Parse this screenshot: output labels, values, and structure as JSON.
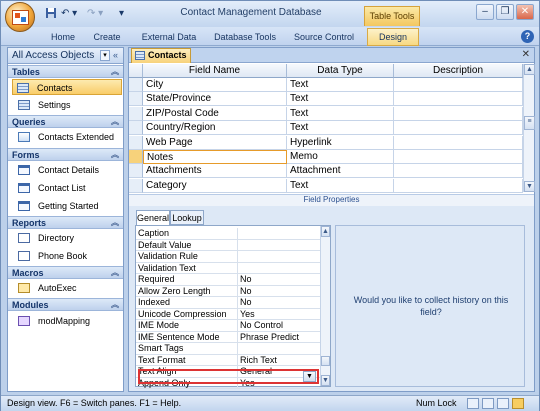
{
  "app": {
    "title": "Contact Management Database",
    "contextual_group": "Table Tools"
  },
  "qat": {
    "undo": "↶ ▾",
    "redo": "↷ ▾",
    "customize": "▾"
  },
  "window_controls": {
    "minimize": "–",
    "restore": "❐",
    "close": "✕"
  },
  "ribbon": {
    "tabs": [
      "Home",
      "Create",
      "External Data",
      "Database Tools",
      "Source Control",
      "Design"
    ],
    "active": "Design"
  },
  "help": "?",
  "nav": {
    "title": "All Access Objects",
    "groups": [
      {
        "label": "Tables",
        "items": [
          "Contacts",
          "Settings"
        ]
      },
      {
        "label": "Queries",
        "items": [
          "Contacts Extended"
        ]
      },
      {
        "label": "Forms",
        "items": [
          "Contact Details",
          "Contact List",
          "Getting Started"
        ]
      },
      {
        "label": "Reports",
        "items": [
          "Directory",
          "Phone Book"
        ]
      },
      {
        "label": "Macros",
        "items": [
          "AutoExec"
        ]
      },
      {
        "label": "Modules",
        "items": [
          "modMapping"
        ]
      }
    ],
    "selected": "Contacts"
  },
  "document": {
    "tab": "Contacts",
    "close": "✕"
  },
  "grid": {
    "columns": [
      "Field Name",
      "Data Type",
      "Description"
    ],
    "rows": [
      {
        "field": "City",
        "type": "Text",
        "desc": ""
      },
      {
        "field": "State/Province",
        "type": "Text",
        "desc": ""
      },
      {
        "field": "ZIP/Postal Code",
        "type": "Text",
        "desc": ""
      },
      {
        "field": "Country/Region",
        "type": "Text",
        "desc": ""
      },
      {
        "field": "Web Page",
        "type": "Hyperlink",
        "desc": ""
      },
      {
        "field": "Notes",
        "type": "Memo",
        "desc": ""
      },
      {
        "field": "Attachments",
        "type": "Attachment",
        "desc": ""
      },
      {
        "field": "Category",
        "type": "Text",
        "desc": ""
      }
    ],
    "current_row": "Notes"
  },
  "field_properties": {
    "label": "Field Properties",
    "tabs": [
      "General",
      "Lookup"
    ],
    "active_tab": "General",
    "rows": [
      {
        "name": "Caption",
        "value": ""
      },
      {
        "name": "Default Value",
        "value": ""
      },
      {
        "name": "Validation Rule",
        "value": ""
      },
      {
        "name": "Validation Text",
        "value": ""
      },
      {
        "name": "Required",
        "value": "No"
      },
      {
        "name": "Allow Zero Length",
        "value": "No"
      },
      {
        "name": "Indexed",
        "value": "No"
      },
      {
        "name": "Unicode Compression",
        "value": "Yes"
      },
      {
        "name": "IME Mode",
        "value": "No Control"
      },
      {
        "name": "IME Sentence Mode",
        "value": "Phrase Predict"
      },
      {
        "name": "Smart Tags",
        "value": ""
      },
      {
        "name": "Text Format",
        "value": "Rich Text"
      },
      {
        "name": "Text Align",
        "value": "General"
      },
      {
        "name": "Append Only",
        "value": "Yes"
      }
    ],
    "help_text": "Would you like to collect history on this field?"
  },
  "status": {
    "text": "Design view.  F6 = Switch panes.  F1 = Help.",
    "numlock": "Num Lock"
  },
  "colors": {
    "accent": "#f7d27b",
    "highlight_border": "#dd3333",
    "frame": "#bcd0ea"
  }
}
